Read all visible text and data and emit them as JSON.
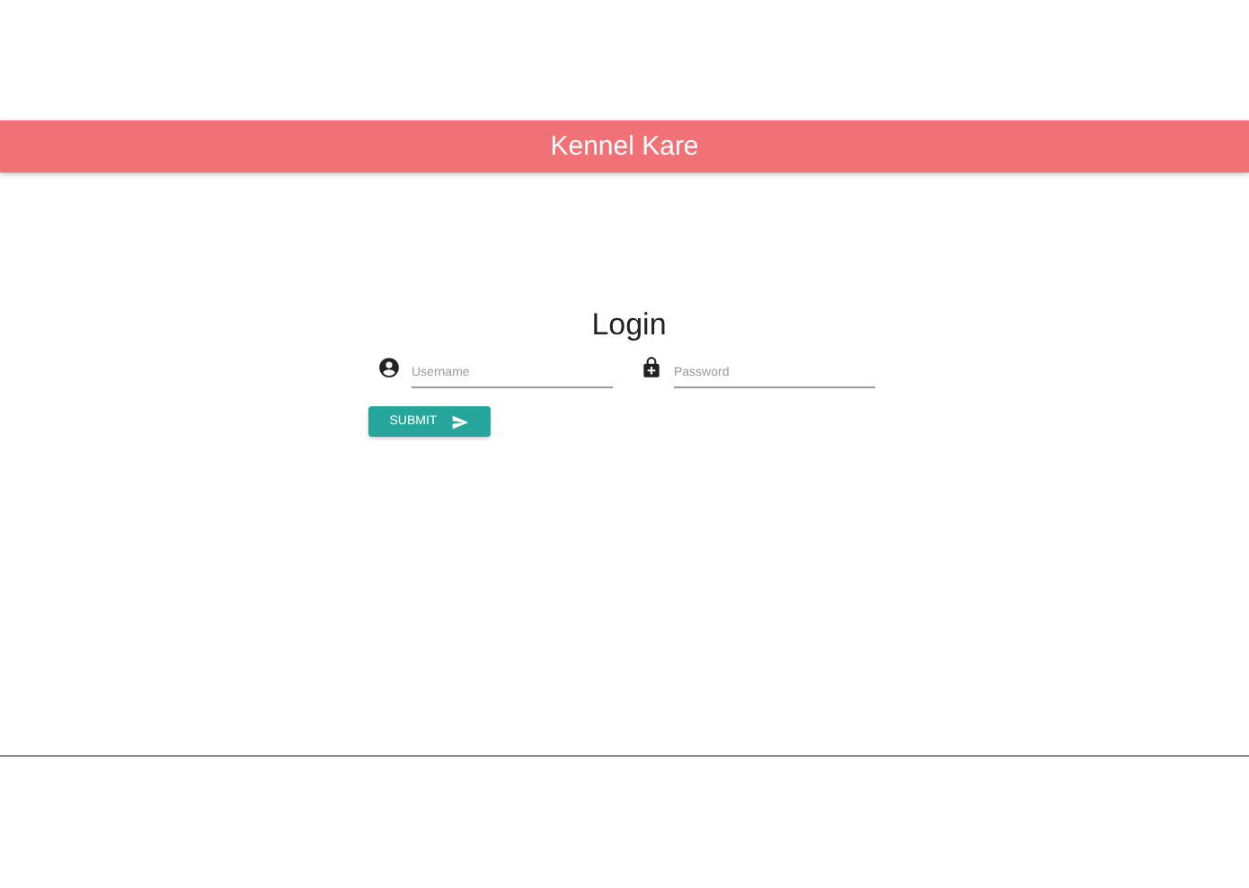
{
  "app_bar": {
    "title": "Kennel Kare"
  },
  "form": {
    "title": "Login",
    "fields": [
      {
        "kind": "user",
        "placeholder": "Username"
      },
      {
        "kind": "lock",
        "placeholder": "Password"
      }
    ],
    "submit": {
      "label": "SUBMIT"
    }
  }
}
